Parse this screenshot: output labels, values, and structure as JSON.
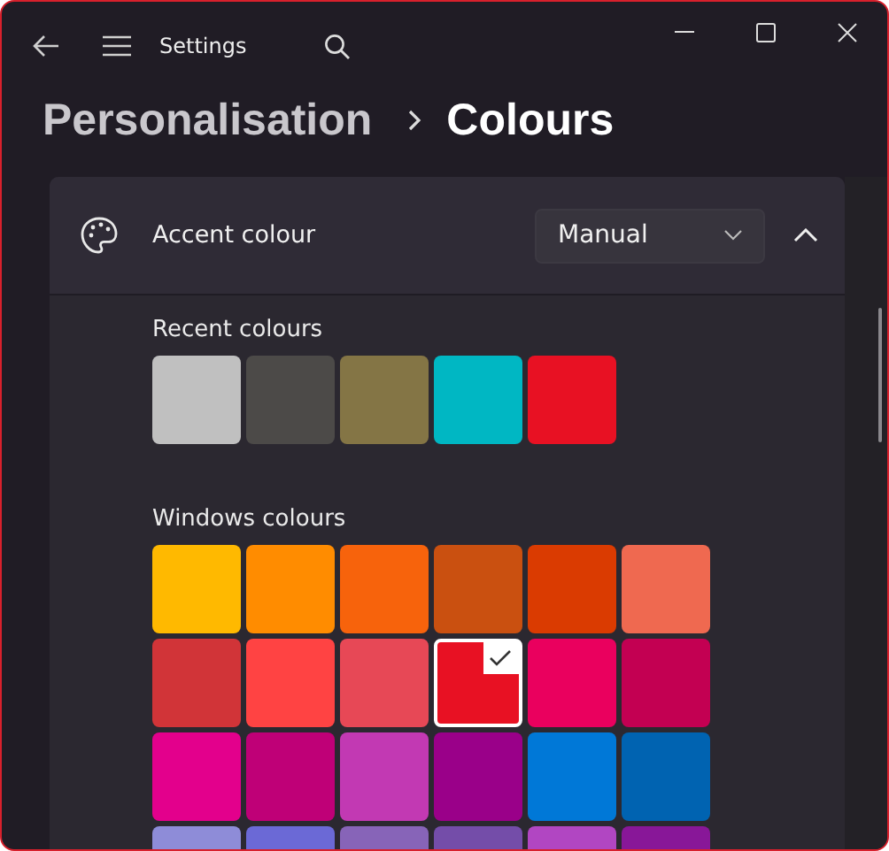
{
  "window": {
    "title": "Settings"
  },
  "breadcrumb": {
    "parent": "Personalisation",
    "current": "Colours"
  },
  "accent": {
    "label": "Accent colour",
    "dropdown": {
      "value": "Manual"
    },
    "expanded": true
  },
  "recent": {
    "label": "Recent colours",
    "swatches": [
      {
        "color": "#c0c0c0"
      },
      {
        "color": "#4c4a48"
      },
      {
        "color": "#847545"
      },
      {
        "color": "#00b7c3"
      },
      {
        "color": "#e81123"
      }
    ]
  },
  "windows_colours": {
    "label": "Windows colours",
    "rows": [
      [
        {
          "color": "#ffb900",
          "selected": false
        },
        {
          "color": "#ff8c00",
          "selected": false
        },
        {
          "color": "#f7630c",
          "selected": false
        },
        {
          "color": "#ca5010",
          "selected": false
        },
        {
          "color": "#da3b01",
          "selected": false
        },
        {
          "color": "#ef6950",
          "selected": false
        }
      ],
      [
        {
          "color": "#d13438",
          "selected": false
        },
        {
          "color": "#ff4343",
          "selected": false
        },
        {
          "color": "#e74856",
          "selected": false
        },
        {
          "color": "#e81123",
          "selected": true
        },
        {
          "color": "#ea005e",
          "selected": false
        },
        {
          "color": "#c30052",
          "selected": false
        }
      ],
      [
        {
          "color": "#e3008c",
          "selected": false
        },
        {
          "color": "#bf0077",
          "selected": false
        },
        {
          "color": "#c239b3",
          "selected": false
        },
        {
          "color": "#9a0089",
          "selected": false
        },
        {
          "color": "#0078d7",
          "selected": false
        },
        {
          "color": "#0063b1",
          "selected": false
        }
      ],
      [
        {
          "color": "#8e8cd8",
          "selected": false
        },
        {
          "color": "#6b69d6",
          "selected": false
        },
        {
          "color": "#8764b8",
          "selected": false
        },
        {
          "color": "#744da9",
          "selected": false
        },
        {
          "color": "#b146c2",
          "selected": false
        },
        {
          "color": "#881798",
          "selected": false
        }
      ]
    ]
  }
}
